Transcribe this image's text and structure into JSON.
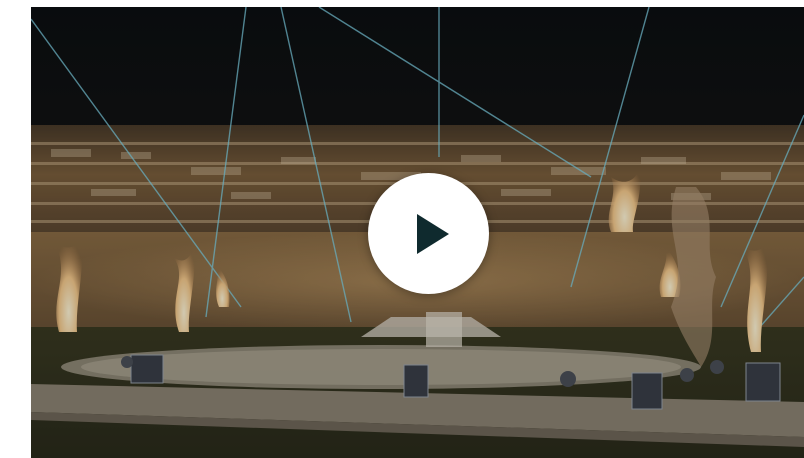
{
  "video": {
    "play_button_label": "Play video",
    "play_icon": "play-icon",
    "accent_color": "#ffffff",
    "icon_color": "#0f2a2e"
  }
}
